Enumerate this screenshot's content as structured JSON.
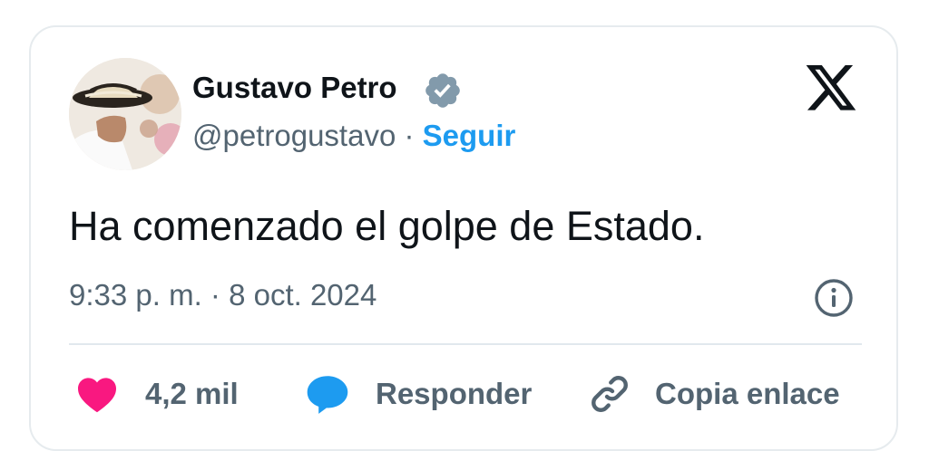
{
  "author": {
    "name": "Gustavo Petro",
    "handle": "@petrogustavo",
    "separator": "·",
    "follow_label": "Seguir",
    "verified_icon": "verified-badge-icon"
  },
  "tweet": {
    "text": "Ha comenzado el golpe de Estado.",
    "timestamp": "9:33 p. m. · 8 oct. 2024"
  },
  "actions": {
    "likes_count": "4,2 mil",
    "reply_label": "Responder",
    "copy_link_label": "Copia enlace"
  },
  "colors": {
    "accent": "#1d9bf0",
    "like": "#f91880",
    "text_primary": "#0f1419",
    "text_secondary": "#536471",
    "verified": "#829aab"
  }
}
